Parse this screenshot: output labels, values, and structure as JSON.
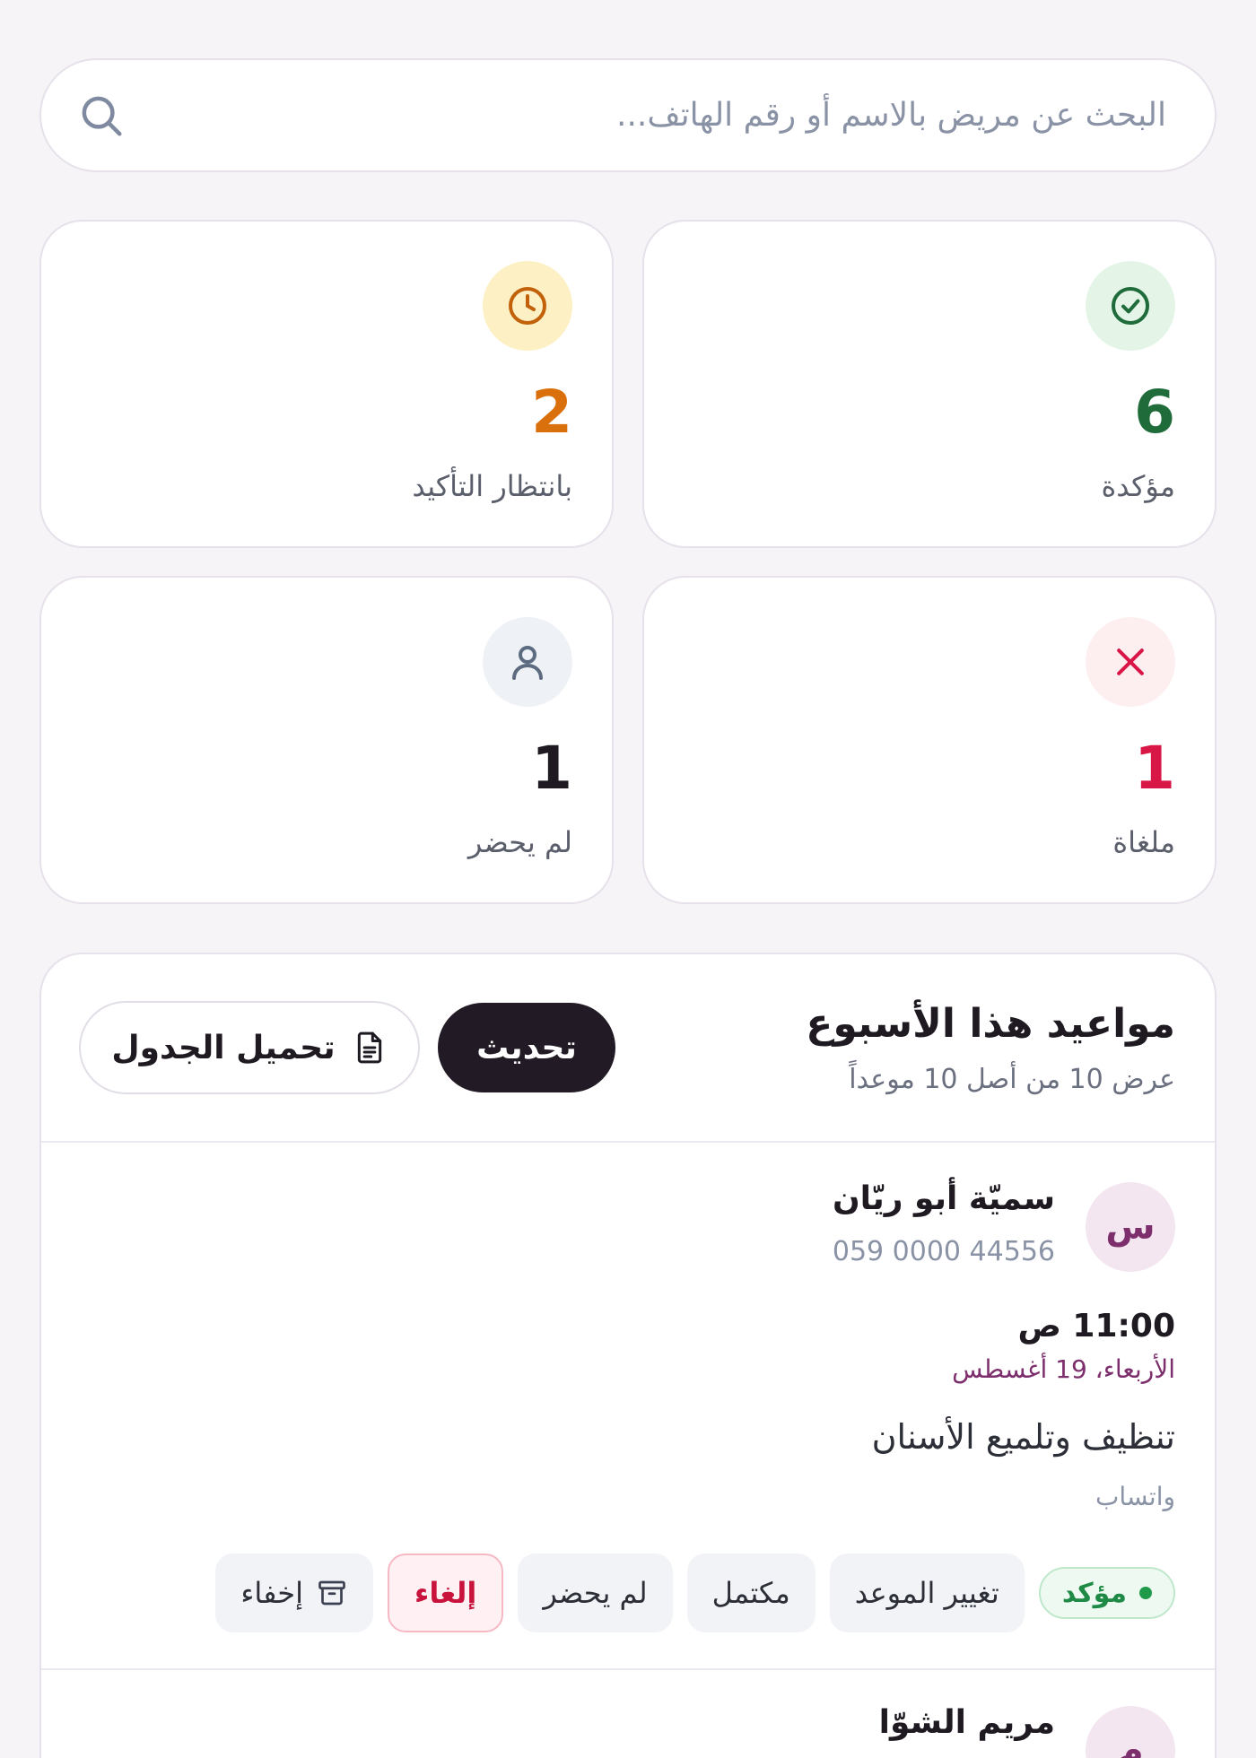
{
  "search": {
    "placeholder": "البحث عن مريض بالاسم أو رقم الهاتف..."
  },
  "stats": [
    {
      "key": "confirmed",
      "value": "6",
      "label": "مؤكدة",
      "color": "#1f6b3a",
      "badge_bg": "#e4f5e8",
      "icon": "check-circle-icon"
    },
    {
      "key": "pending",
      "value": "2",
      "label": "بانتظار التأكيد",
      "color": "#d9700b",
      "badge_bg": "#fdf0c4",
      "icon": "clock-icon"
    },
    {
      "key": "cancelled",
      "value": "1",
      "label": "ملغاة",
      "color": "#d81747",
      "badge_bg": "#fdeef0",
      "icon": "x-icon"
    },
    {
      "key": "no_show",
      "value": "1",
      "label": "لم يحضر",
      "color": "#1f1a22",
      "badge_bg": "#eef2f6",
      "icon": "user-icon"
    }
  ],
  "panel": {
    "title": "مواعيد هذا الأسبوع",
    "subtitle": "عرض 10 من أصل 10 موعداً",
    "refresh_label": "تحديث",
    "download_label": "تحميل الجدول"
  },
  "appointments": [
    {
      "initial": "س",
      "name": "سميّة أبو ريّان",
      "phone": "059 0000 44556",
      "time": "11:00 ص",
      "date": "الأربعاء، 19 أغسطس",
      "service": "تنظيف وتلميع الأسنان",
      "source": "واتساب",
      "status": "مؤكد",
      "actions": {
        "reschedule": "تغيير الموعد",
        "complete": "مكتمل",
        "no_show": "لم يحضر",
        "cancel": "إلغاء",
        "hide": "إخفاء"
      }
    },
    {
      "initial": "م",
      "name": "مريم الشوّا"
    }
  ]
}
